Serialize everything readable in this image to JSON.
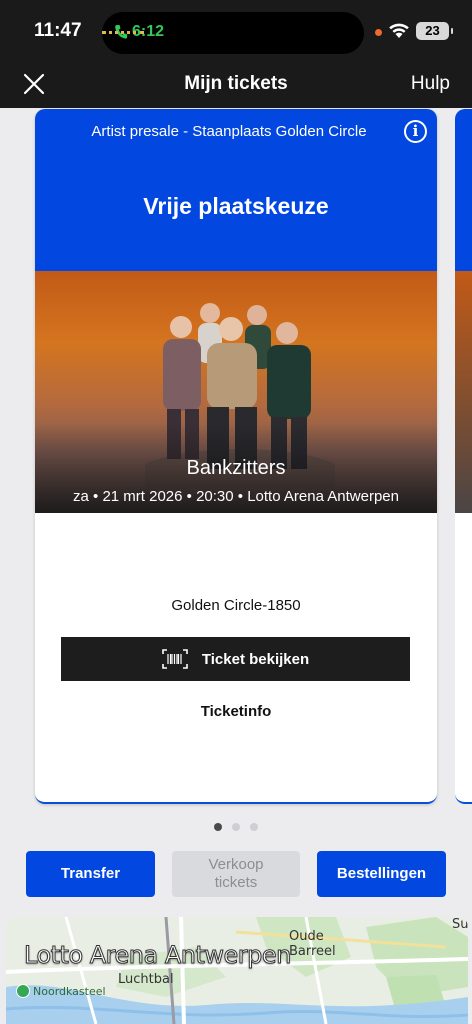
{
  "status_bar": {
    "time": "11:47",
    "call_time": "6:12",
    "battery": "23"
  },
  "nav": {
    "title": "Mijn tickets",
    "help": "Hulp"
  },
  "ticket": {
    "presale": "Artist presale - Staanplaats Golden Circle",
    "seat_type": "Vrije plaatskeuze",
    "artist": "Bankzitters",
    "event_line": "za • 21 mrt 2026 • 20:30 • Lotto Arena Antwerpen",
    "section": "Golden Circle-1850",
    "view_button": "Ticket bekijken",
    "info_link": "Ticketinfo"
  },
  "pagination": {
    "count": 3,
    "active": 0
  },
  "actions": {
    "transfer": "Transfer",
    "sell": "Verkoop tickets",
    "orders": "Bestellingen"
  },
  "map": {
    "venue": "Lotto Arena Antwerpen",
    "labels": {
      "oude_barreel": "Oude Barreel",
      "luchtbal": "Luchtbal",
      "noordkasteel": "Noordkasteel",
      "edge": "Su"
    }
  },
  "colors": {
    "brand_blue": "#0247e0",
    "dark": "#1a1a1a",
    "call_green": "#34c759"
  }
}
